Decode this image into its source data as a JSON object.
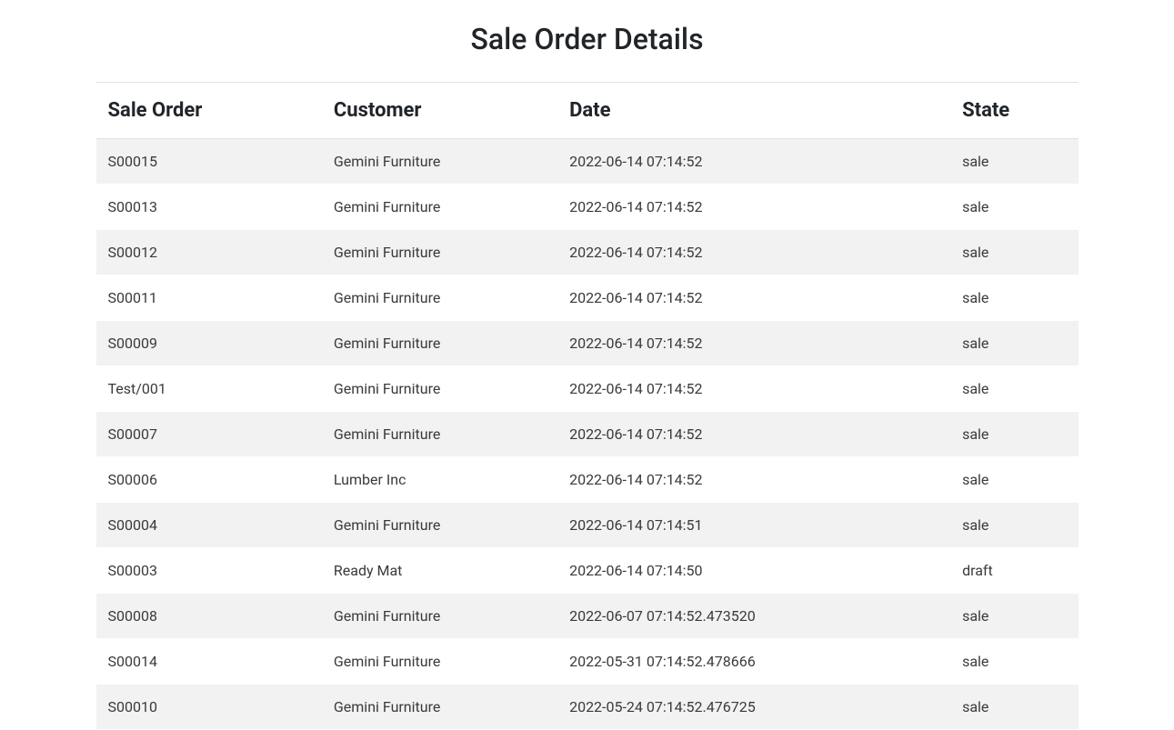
{
  "page": {
    "title": "Sale Order Details"
  },
  "table": {
    "headers": {
      "sale_order": "Sale Order",
      "customer": "Customer",
      "date": "Date",
      "state": "State"
    },
    "rows": [
      {
        "sale_order": "S00015",
        "customer": "Gemini Furniture",
        "date": "2022-06-14 07:14:52",
        "state": "sale"
      },
      {
        "sale_order": "S00013",
        "customer": "Gemini Furniture",
        "date": "2022-06-14 07:14:52",
        "state": "sale"
      },
      {
        "sale_order": "S00012",
        "customer": "Gemini Furniture",
        "date": "2022-06-14 07:14:52",
        "state": "sale"
      },
      {
        "sale_order": "S00011",
        "customer": "Gemini Furniture",
        "date": "2022-06-14 07:14:52",
        "state": "sale"
      },
      {
        "sale_order": "S00009",
        "customer": "Gemini Furniture",
        "date": "2022-06-14 07:14:52",
        "state": "sale"
      },
      {
        "sale_order": "Test/001",
        "customer": "Gemini Furniture",
        "date": "2022-06-14 07:14:52",
        "state": "sale"
      },
      {
        "sale_order": "S00007",
        "customer": "Gemini Furniture",
        "date": "2022-06-14 07:14:52",
        "state": "sale"
      },
      {
        "sale_order": "S00006",
        "customer": "Lumber Inc",
        "date": "2022-06-14 07:14:52",
        "state": "sale"
      },
      {
        "sale_order": "S00004",
        "customer": "Gemini Furniture",
        "date": "2022-06-14 07:14:51",
        "state": "sale"
      },
      {
        "sale_order": "S00003",
        "customer": "Ready Mat",
        "date": "2022-06-14 07:14:50",
        "state": "draft"
      },
      {
        "sale_order": "S00008",
        "customer": "Gemini Furniture",
        "date": "2022-06-07 07:14:52.473520",
        "state": "sale"
      },
      {
        "sale_order": "S00014",
        "customer": "Gemini Furniture",
        "date": "2022-05-31 07:14:52.478666",
        "state": "sale"
      },
      {
        "sale_order": "S00010",
        "customer": "Gemini Furniture",
        "date": "2022-05-24 07:14:52.476725",
        "state": "sale"
      }
    ]
  }
}
